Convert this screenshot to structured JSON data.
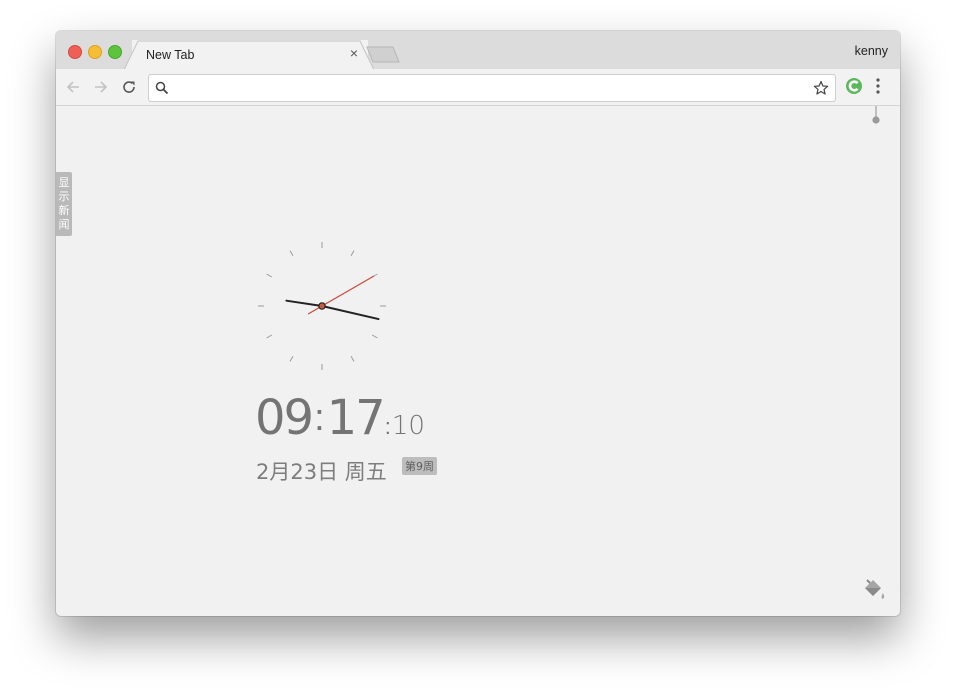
{
  "browser": {
    "tab_title": "New Tab",
    "tab_close": "×",
    "profile_name": "kenny",
    "omnibox": {
      "value": "",
      "placeholder": ""
    }
  },
  "newtab": {
    "news_toggle_label": "显示新闻",
    "time": {
      "hours": "09",
      "minutes": "17",
      "seconds": "10",
      "separator": ":"
    },
    "date_text": "2月23日 周五",
    "week_badge": "第9周",
    "clock": {
      "hour": 9,
      "minute": 17,
      "second": 10
    }
  },
  "colors": {
    "second_hand": "#d0453a",
    "extension_icon": "#5cb85c"
  },
  "icons": {
    "back": "arrow-left-icon",
    "forward": "arrow-right-icon",
    "reload": "reload-icon",
    "search": "search-icon",
    "bookmark": "star-icon",
    "extension": "extension-icon",
    "menu": "kebab-menu-icon",
    "theme": "paint-bucket-icon"
  }
}
